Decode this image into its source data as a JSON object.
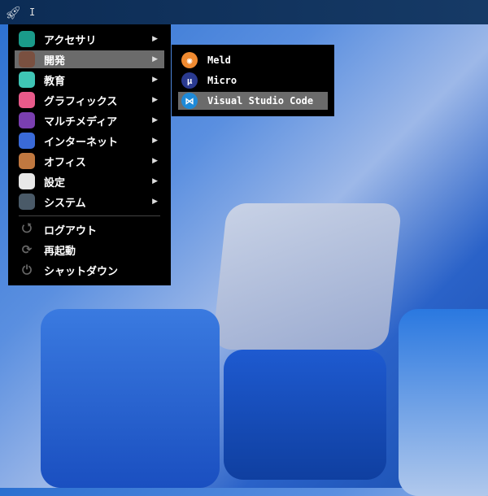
{
  "taskbar": {
    "cursor": "I"
  },
  "menu": {
    "items": [
      {
        "label": "アクセサリ",
        "icon": "accessories-icon",
        "color": "#1a9b8a"
      },
      {
        "label": "開発",
        "icon": "development-hammer-icon",
        "color": "#7a5040"
      },
      {
        "label": "教育",
        "icon": "education-icon",
        "color": "#3fc5b5"
      },
      {
        "label": "グラフィックス",
        "icon": "graphics-icon",
        "color": "#e85a8a"
      },
      {
        "label": "マルチメディア",
        "icon": "multimedia-icon",
        "color": "#7a3fb0"
      },
      {
        "label": "インターネット",
        "icon": "internet-icon",
        "color": "#3a6ad8"
      },
      {
        "label": "オフィス",
        "icon": "office-briefcase-icon",
        "color": "#c07840"
      },
      {
        "label": "設定",
        "icon": "settings-icon",
        "color": "#e8e8e8"
      },
      {
        "label": "システム",
        "icon": "system-gear-icon",
        "color": "#4a5a68"
      }
    ],
    "actions": [
      {
        "label": "ログアウト",
        "icon": "logout-icon",
        "glyph": "⭯"
      },
      {
        "label": "再起動",
        "icon": "restart-icon",
        "glyph": "⟳"
      },
      {
        "label": "シャットダウン",
        "icon": "power-icon",
        "glyph": "⏻"
      }
    ],
    "arrow": "▶"
  },
  "submenu": {
    "items": [
      {
        "label": "Meld",
        "icon": "meld-icon",
        "color": "#f08a30",
        "glyph": "◉"
      },
      {
        "label": "Micro",
        "icon": "micro-icon",
        "color": "#2a3a90",
        "glyph": "μ"
      },
      {
        "label": "Visual Studio Code",
        "icon": "vscode-icon",
        "color": "#1f8ad8",
        "glyph": "⋈"
      }
    ]
  }
}
